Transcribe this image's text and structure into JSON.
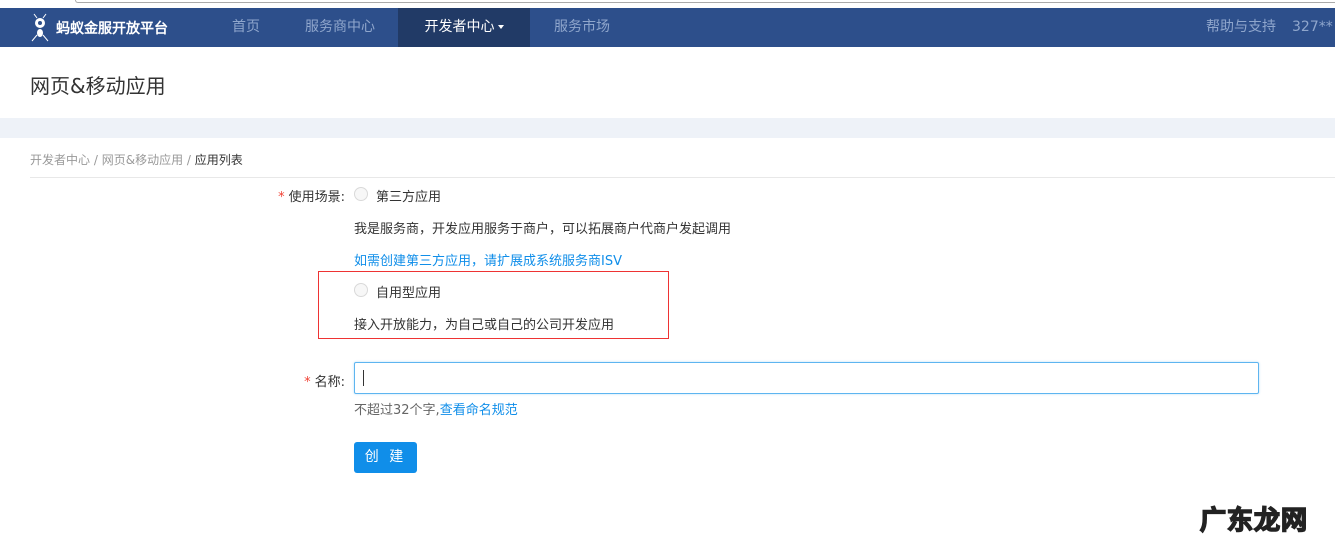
{
  "nav": {
    "brand": "蚂蚁金服开放平台",
    "items": [
      {
        "label": "首页"
      },
      {
        "label": "服务商中心"
      },
      {
        "label": "开发者中心"
      },
      {
        "label": "服务市场"
      }
    ],
    "help": "帮助与支持",
    "user": "327**"
  },
  "page": {
    "title": "网页&移动应用"
  },
  "breadcrumb": {
    "items": [
      "开发者中心",
      "网页&移动应用",
      "应用列表"
    ],
    "separator": "/"
  },
  "form": {
    "scene_label": "使用场景:",
    "options": [
      {
        "label": "第三方应用",
        "desc": "我是服务商，开发应用服务于商户，可以拓展商户代商户发起调用",
        "link": "如需创建第三方应用，请扩展成系统服务商ISV"
      },
      {
        "label": "自用型应用",
        "desc": "接入开放能力，为自己或自己的公司开发应用"
      }
    ],
    "name_label": "名称:",
    "name_value": "",
    "hint": "不超过32个字,",
    "hint_link": "查看命名规范",
    "submit": "创 建"
  },
  "watermark": "广东龙网",
  "colors": {
    "nav": "#2d4f8b",
    "nav_active": "#213a66",
    "primary": "#108ee9",
    "highlight": "#e33333"
  }
}
